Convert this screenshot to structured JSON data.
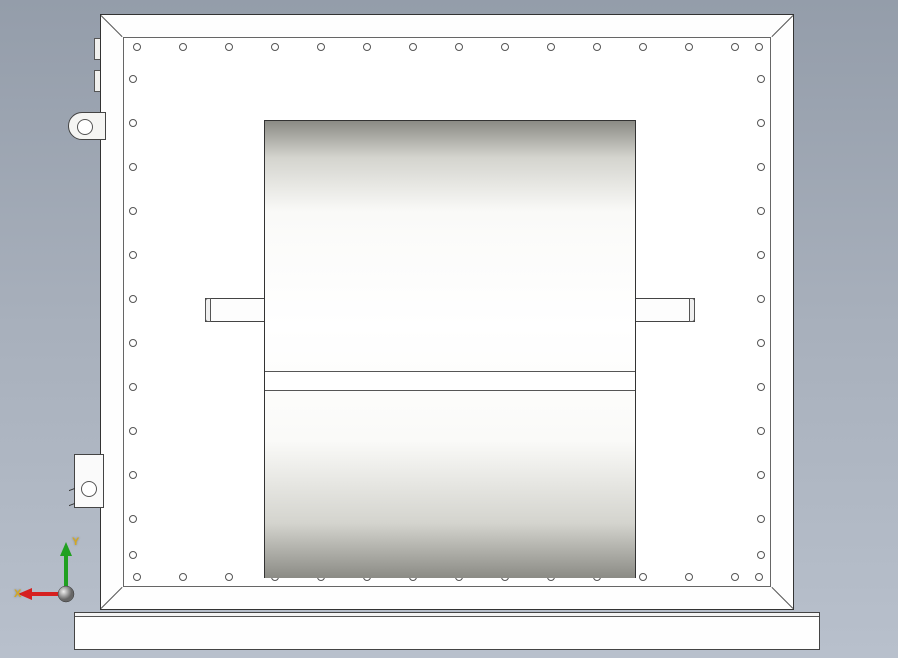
{
  "triad": {
    "x_label": "X",
    "y_label": "Y",
    "x_color": "#d62020",
    "y_color": "#20a020",
    "z_color": "#2050d0"
  },
  "enclosure": {
    "bolt_hole_count_top": 15,
    "bolt_hole_count_bottom": 15,
    "bolt_hole_count_side": 12
  }
}
